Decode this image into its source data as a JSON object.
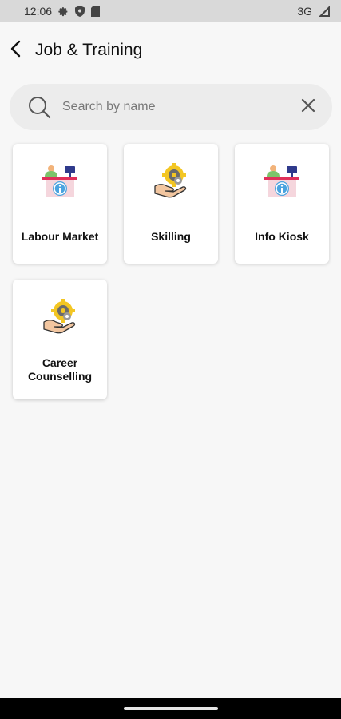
{
  "status_bar": {
    "time": "12:06",
    "network": "3G",
    "icons": [
      "gear-icon",
      "shield-icon",
      "sim-card-icon",
      "signal-icon"
    ]
  },
  "header": {
    "title": "Job & Training",
    "back_icon": "chevron-left-icon"
  },
  "search": {
    "placeholder": "Search by name",
    "value": "",
    "search_icon": "search-icon",
    "clear_icon": "close-icon"
  },
  "cards": [
    {
      "label": "Labour Market",
      "icon": "info-desk-icon"
    },
    {
      "label": "Skilling",
      "icon": "hand-gear-icon"
    },
    {
      "label": "Info Kiosk",
      "icon": "info-desk-icon"
    },
    {
      "label_line1": "Career",
      "label_line2": "Counselling",
      "icon": "hand-gear-icon"
    }
  ],
  "colors": {
    "background": "#f7f7f7",
    "status_bar": "#d9d9d9",
    "search_bg": "#ececec",
    "card_bg": "#ffffff",
    "accent_red": "#e0305a",
    "accent_blue": "#4aa3df",
    "accent_yellow": "#f3c623"
  }
}
